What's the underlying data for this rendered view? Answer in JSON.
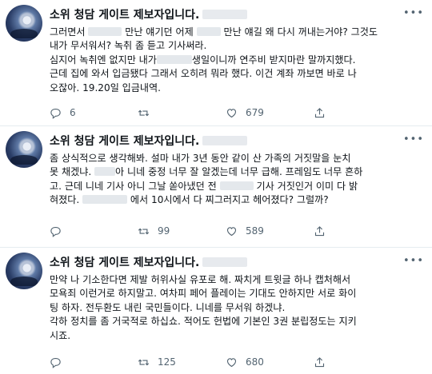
{
  "tweets": [
    {
      "author": "소위 청담 게이트 제보자입니다.",
      "lines": [
        "그러면서 {b:42} 만난 얘기던 어제 {b:30} 만난 얘길 왜 다시 꺼내는거야? 그것도",
        "내가 무서워서? 녹취 좀 듣고 기사써라.",
        "심지어 녹취엔 없지만 내가{b:44}생일이니까 연주비 받지마란 말까지했다.",
        "근데 집에 와서 입금됐다 그래서 오히려 뭐라 했다. 이건 계좌 까보면 바로 나",
        "오잖아. 19.20일 입금내역."
      ],
      "replies": "6",
      "retweets": "",
      "likes": "679"
    },
    {
      "author": "소위 청담 게이트 제보자입니다.",
      "lines": [
        "좀 상식적으로 생각해봐. 설마 내가 3년 동안 같이 산 가족의 거짓말을 눈치",
        "못 채겠냐. {b:26}아 니네 중정 너무 잘 알겠는데 너무 급해. 프레임도 너무 흔하",
        "고. 근데 니네 기사 아니 그날 쏟아냈던 전 {b:42} 기사 거짓인거 이미 다 밝",
        "혀졌다. {b:56} 에서 10시에서 다 찌그러지고 헤어졌다? 그럴까?"
      ],
      "replies": "",
      "retweets": "99",
      "likes": "589"
    },
    {
      "author": "소위 청담 게이트 제보자입니다.",
      "lines": [
        "만약 나 기소한다면 제발 허위사실 유포로 해. 짜치게 트윗글 하나 캡처해서",
        "모욕죄 이런거로 하지말고. 여차피 페어 플레이는 기대도 안하지만 서로 화이",
        "팅 하자. 전두환도 내린 국민들이다. 니네를 무서워 하겠냐.",
        "각하 정치를 좀 거국적로 하십쇼. 적어도 헌법에 기본인 3권 분립정도는 지키",
        "시죠."
      ],
      "replies": "",
      "retweets": "125",
      "likes": "680"
    }
  ]
}
